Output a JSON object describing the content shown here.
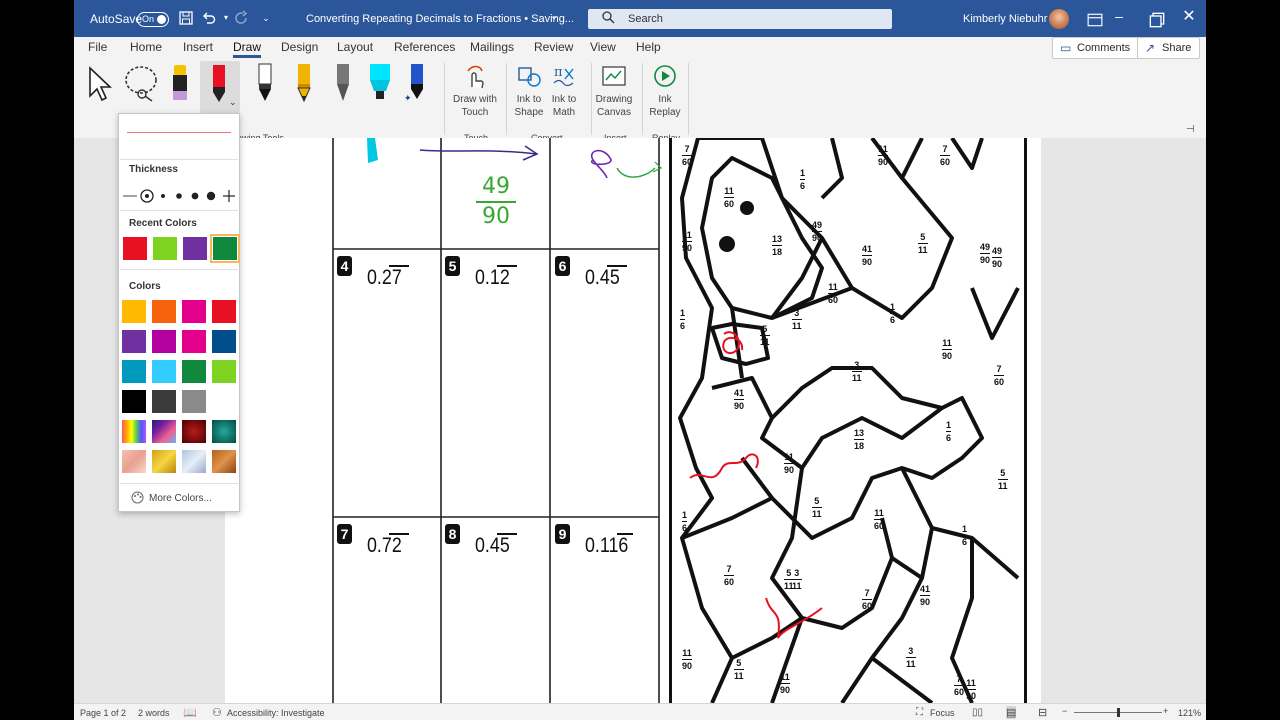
{
  "titlebar": {
    "autosave_label": "AutoSave",
    "autosave_state": "On",
    "doc_title": "Converting Repeating Decimals to Fractions • Saving...",
    "search_placeholder": "Search",
    "user_name": "Kimberly Niebuhr"
  },
  "menu": {
    "tabs": [
      "File",
      "Home",
      "Insert",
      "Draw",
      "Design",
      "Layout",
      "References",
      "Mailings",
      "Review",
      "View",
      "Help"
    ],
    "active_tab": "Draw",
    "comments_label": "Comments",
    "share_label": "Share"
  },
  "ribbon": {
    "groups": {
      "drawing_tools": "rawing Tools",
      "touch": "Touch",
      "convert": "Convert",
      "insert": "Insert",
      "replay": "Replay"
    },
    "buttons": {
      "draw_with_touch": [
        "Draw with",
        "Touch"
      ],
      "ink_to_shape": [
        "Ink to",
        "Shape"
      ],
      "ink_to_math": [
        "Ink to",
        "Math"
      ],
      "drawing_canvas": [
        "Drawing",
        "Canvas"
      ],
      "ink_replay": [
        "Ink",
        "Replay"
      ]
    },
    "pens": [
      {
        "name": "pencil-black",
        "color": "#1a1a1a"
      },
      {
        "name": "pen-red",
        "color": "#e81123"
      },
      {
        "name": "pen-black",
        "color": "#111111"
      },
      {
        "name": "pencil-yellow",
        "color": "#f0b400"
      },
      {
        "name": "pencil-gray",
        "color": "#555555"
      },
      {
        "name": "highlighter-cyan",
        "color": "#00e5ff"
      },
      {
        "name": "pen-blue-galaxy",
        "color": "#2255cc"
      }
    ]
  },
  "pen_dropdown": {
    "thickness_label": "Thickness",
    "recent_colors_label": "Recent Colors",
    "colors_label": "Colors",
    "more_colors_label": "More Colors...",
    "recent_colors": [
      "#e81123",
      "#7ed321",
      "#7030a0",
      "#10893e"
    ],
    "colors": [
      [
        "#ffb900",
        "#f7630c",
        "#e3008c",
        "#e81123"
      ],
      [
        "#7030a0",
        "#b4009e",
        "#e3008c",
        "#004e8c"
      ],
      [
        "#0099bc",
        "#33ccff",
        "#10893e",
        "#7ed321"
      ],
      [
        "#000000",
        "#3b3b3b",
        "#8a8a8a",
        "#ffffff"
      ]
    ]
  },
  "worksheet": {
    "problems": [
      {
        "num": "4",
        "decimal": "0.27",
        "repeat": "27"
      },
      {
        "num": "5",
        "decimal": "0.12",
        "repeat": "12"
      },
      {
        "num": "6",
        "decimal": "0.45",
        "repeat": "45"
      },
      {
        "num": "7",
        "decimal": "0.72",
        "repeat": "72"
      },
      {
        "num": "8",
        "decimal": "0.45",
        "repeat": "45"
      },
      {
        "num": "9",
        "decimal": "0.116",
        "repeat": "16"
      }
    ],
    "handwritten_fraction": {
      "numerator": "49",
      "denominator": "90"
    },
    "handwritten_9": "9"
  },
  "coloring_fractions": [
    {
      "n": "7",
      "d": "60"
    },
    {
      "n": "1",
      "d": "6"
    },
    {
      "n": "11",
      "d": "90"
    },
    {
      "n": "7",
      "d": "60"
    },
    {
      "n": "11",
      "d": "60"
    },
    {
      "n": "13",
      "d": "18"
    },
    {
      "n": "49",
      "d": "90"
    },
    {
      "n": "11",
      "d": "90"
    },
    {
      "n": "41",
      "d": "90"
    },
    {
      "n": "5",
      "d": "11"
    },
    {
      "n": "49",
      "d": "90"
    },
    {
      "n": "11",
      "d": "60"
    },
    {
      "n": "1",
      "d": "6"
    },
    {
      "n": "5",
      "d": "11"
    },
    {
      "n": "3",
      "d": "11"
    },
    {
      "n": "1",
      "d": "6"
    },
    {
      "n": "11",
      "d": "90"
    },
    {
      "n": "3",
      "d": "11"
    },
    {
      "n": "7",
      "d": "60"
    },
    {
      "n": "41",
      "d": "90"
    },
    {
      "n": "13",
      "d": "18"
    },
    {
      "n": "1",
      "d": "6"
    },
    {
      "n": "11",
      "d": "90"
    },
    {
      "n": "5",
      "d": "11"
    },
    {
      "n": "1",
      "d": "6"
    },
    {
      "n": "5",
      "d": "11"
    },
    {
      "n": "11",
      "d": "60"
    },
    {
      "n": "1",
      "d": "6"
    },
    {
      "n": "5",
      "d": "11"
    },
    {
      "n": "7",
      "d": "60"
    },
    {
      "n": "3",
      "d": "11"
    },
    {
      "n": "7",
      "d": "60"
    },
    {
      "n": "41",
      "d": "90"
    },
    {
      "n": "11",
      "d": "90"
    },
    {
      "n": "11",
      "d": "90"
    },
    {
      "n": "5",
      "d": "11"
    },
    {
      "n": "3",
      "d": "11"
    },
    {
      "n": "7",
      "d": "60"
    },
    {
      "n": "11",
      "d": "90"
    },
    {
      "n": "49",
      "d": "90"
    }
  ],
  "statusbar": {
    "page": "Page 1 of 2",
    "words": "2 words",
    "accessibility": "Accessibility: Investigate",
    "focus": "Focus",
    "zoom": "121%"
  }
}
